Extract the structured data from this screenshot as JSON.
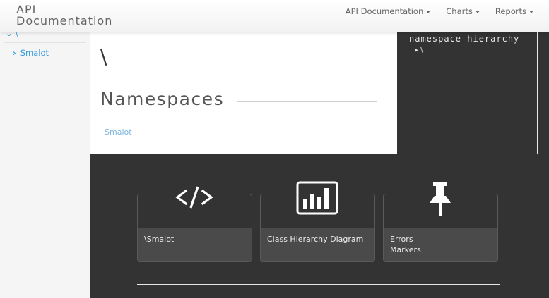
{
  "header": {
    "brand_line1": "API",
    "brand_line2": "Documentation",
    "nav": [
      {
        "label": "API Documentation"
      },
      {
        "label": "Charts"
      },
      {
        "label": "Reports"
      }
    ]
  },
  "sidebar": {
    "root_label": "\\",
    "items": [
      {
        "label": "Smalot"
      }
    ]
  },
  "main": {
    "namespace_title": "\\",
    "section_heading": "Namespaces",
    "namespaces": [
      {
        "label": "Smalot"
      }
    ]
  },
  "hierarchy": {
    "title": "namespace hierarchy",
    "root_item": "\\"
  },
  "cards": [
    {
      "label": "\\Smalot",
      "icon": "code-icon"
    },
    {
      "label": "Class Hierarchy Diagram",
      "icon": "bar-chart-icon"
    },
    {
      "label_line1": "Errors",
      "label_line2": "Markers",
      "icon": "pushpin-icon"
    }
  ],
  "colors": {
    "link": "#3399dd",
    "dark_bg": "#333333",
    "card_bottom": "#4a4a4a"
  }
}
